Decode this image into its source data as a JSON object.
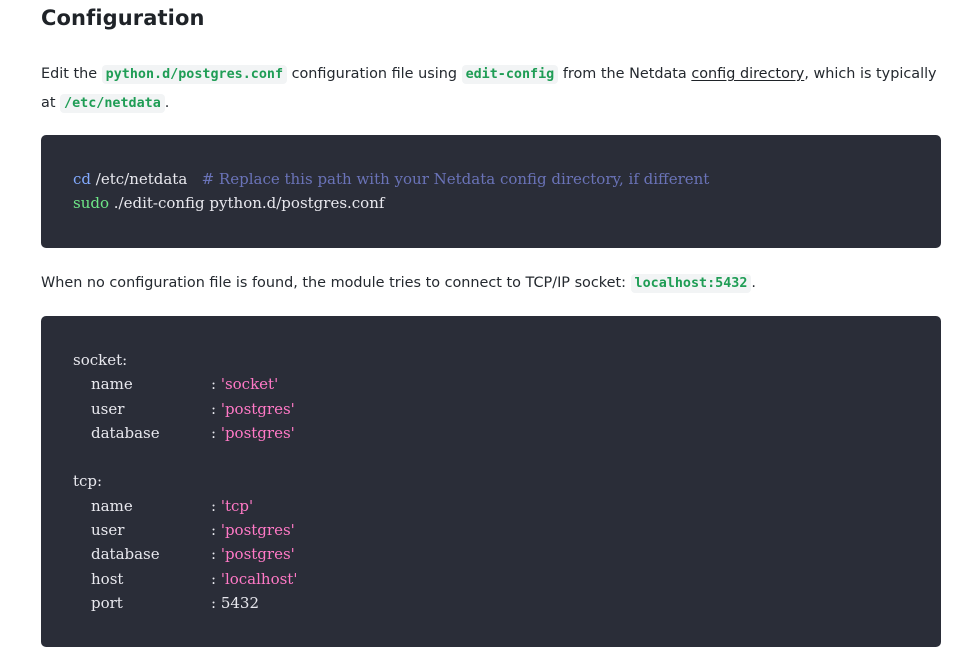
{
  "heading": "Configuration",
  "para1": {
    "t1": "Edit the ",
    "code1": "python.d/postgres.conf",
    "t2": " configuration file using ",
    "code2": "edit-config",
    "t3": " from the Netdata ",
    "link": "config directory",
    "t4": ", which is typically at ",
    "code3": "/etc/netdata",
    "t5": "."
  },
  "code1": {
    "cmd1": "cd",
    "arg1": " /etc/netdata   ",
    "comment": "# Replace this path with your Netdata config directory, if different",
    "cmd2": "sudo",
    "arg2": " ./edit-config python.d/postgres.conf"
  },
  "para2": {
    "t1": "When no configuration file is found, the module tries to connect to TCP/IP socket: ",
    "code": "localhost:5432",
    "t2": "."
  },
  "code2": {
    "socket_header": "socket:",
    "socket_rows": [
      {
        "key": "name",
        "sep": ": ",
        "value": "'socket'"
      },
      {
        "key": "user",
        "sep": ": ",
        "value": "'postgres'"
      },
      {
        "key": "database",
        "sep": ": ",
        "value": "'postgres'"
      }
    ],
    "tcp_header": "tcp:",
    "tcp_rows": [
      {
        "key": "name",
        "sep": ": ",
        "value": "'tcp'"
      },
      {
        "key": "user",
        "sep": ": ",
        "value": "'postgres'"
      },
      {
        "key": "database",
        "sep": ": ",
        "value": "'postgres'"
      },
      {
        "key": "host",
        "sep": ": ",
        "value": "'localhost'"
      },
      {
        "key": "port",
        "sep": ": ",
        "value": "5432"
      }
    ]
  }
}
